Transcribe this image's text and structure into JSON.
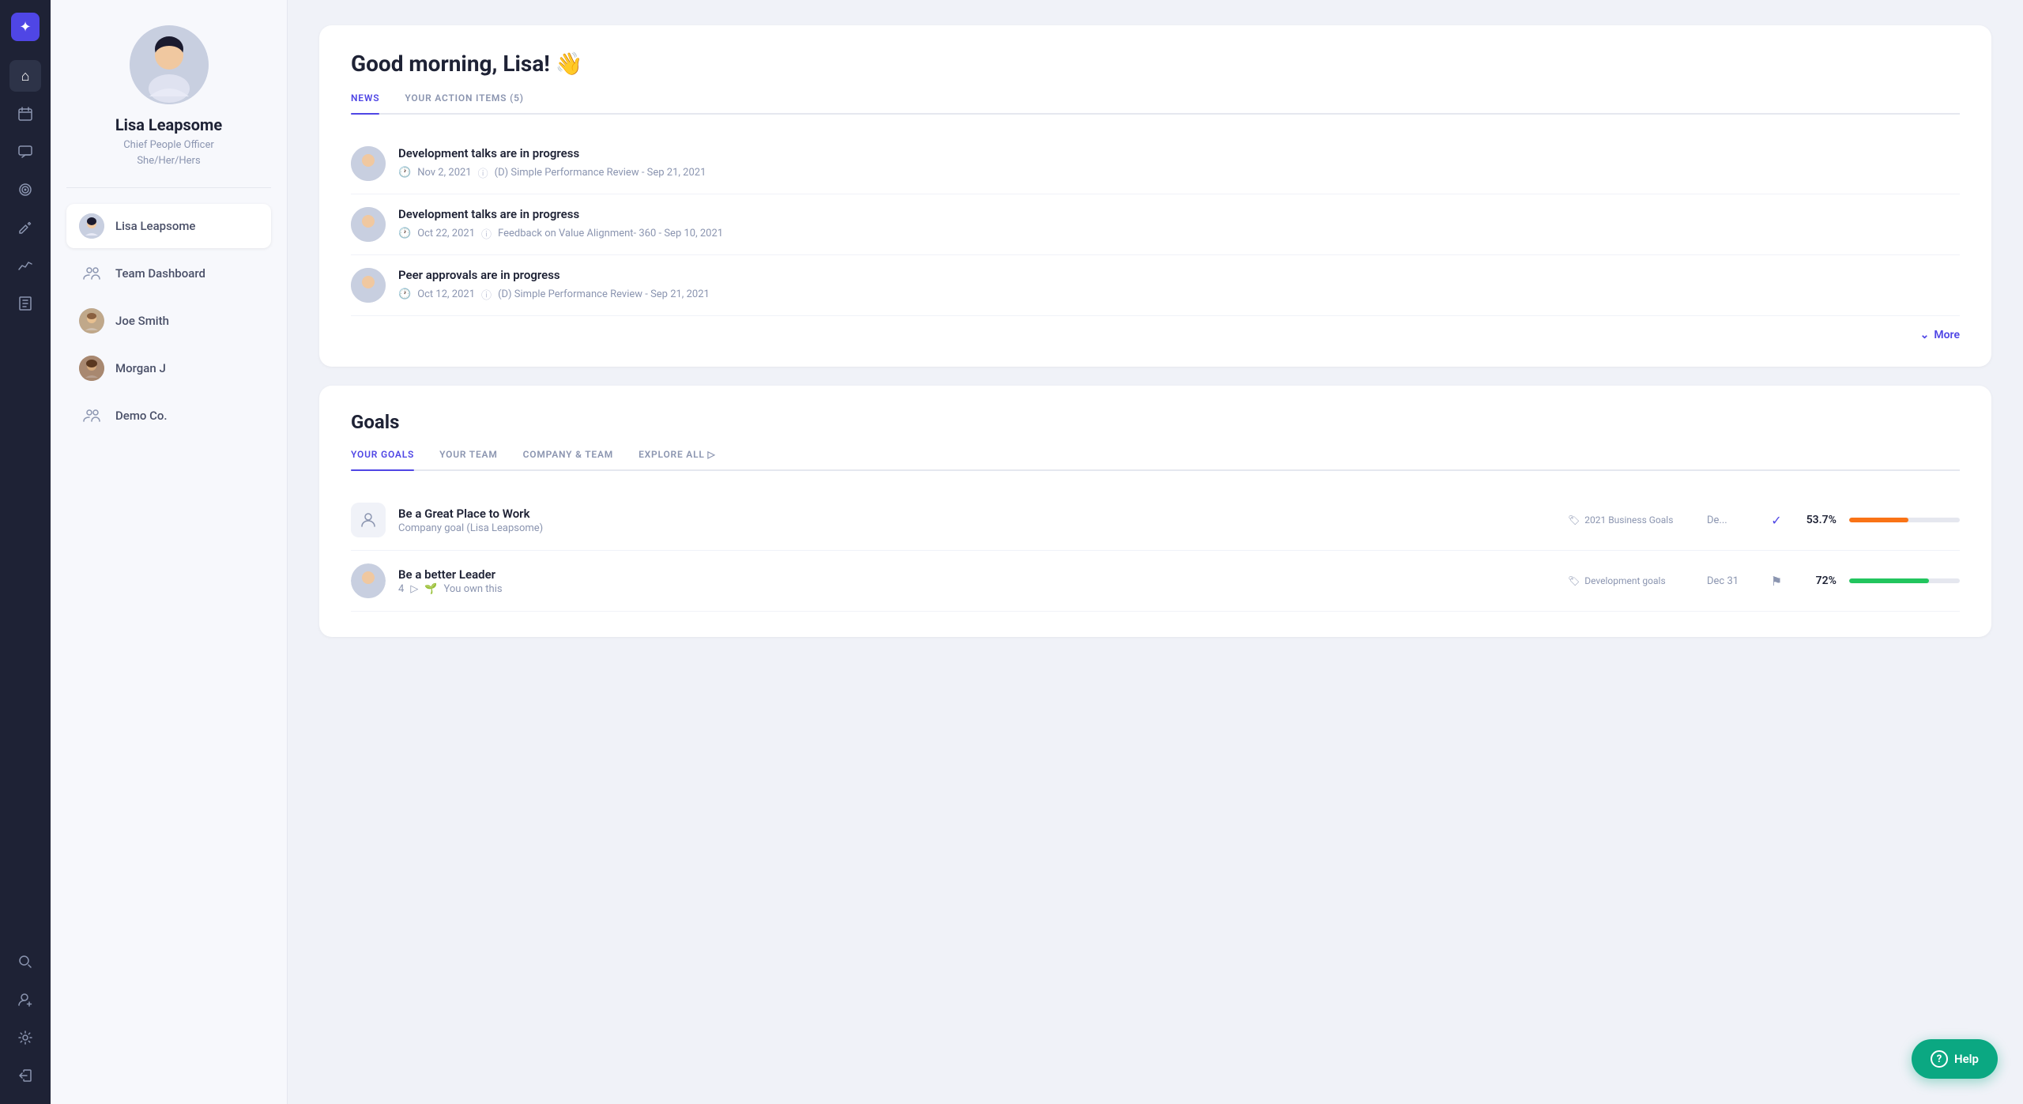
{
  "app": {
    "logo": "✦"
  },
  "sidebar_icons": [
    {
      "name": "home-icon",
      "glyph": "⌂",
      "active": true
    },
    {
      "name": "calendar-icon",
      "glyph": "▦"
    },
    {
      "name": "chat-icon",
      "glyph": "💬"
    },
    {
      "name": "target-icon",
      "glyph": "◎"
    },
    {
      "name": "edit-icon",
      "glyph": "✎"
    },
    {
      "name": "chart-icon",
      "glyph": "∿"
    },
    {
      "name": "book-icon",
      "glyph": "☰"
    }
  ],
  "sidebar_bottom_icons": [
    {
      "name": "search-icon",
      "glyph": "⌕"
    },
    {
      "name": "add-icon",
      "glyph": "+"
    },
    {
      "name": "settings-icon",
      "glyph": "⚙"
    },
    {
      "name": "logout-icon",
      "glyph": "→"
    }
  ],
  "profile": {
    "name": "Lisa Leapsome",
    "title": "Chief People Officer",
    "pronouns": "She/Her/Hers",
    "avatar_emoji": "👩"
  },
  "nav_items": [
    {
      "id": "lisa",
      "label": "Lisa Leapsome",
      "type": "avatar",
      "avatar_emoji": "👩",
      "active": true
    },
    {
      "id": "team",
      "label": "Team Dashboard",
      "type": "group"
    },
    {
      "id": "joe",
      "label": "Joe Smith",
      "type": "avatar",
      "avatar_emoji": "👨"
    },
    {
      "id": "morgan",
      "label": "Morgan J",
      "type": "avatar",
      "avatar_emoji": "👩‍🦱"
    },
    {
      "id": "demo",
      "label": "Demo Co.",
      "type": "group"
    }
  ],
  "news": {
    "greeting": "Good morning, Lisa! 👋",
    "tabs": [
      {
        "label": "NEWS",
        "active": true
      },
      {
        "label": "YOUR ACTION ITEMS (5)",
        "active": false
      }
    ],
    "items": [
      {
        "title": "Development talks are in progress",
        "date": "Nov 2, 2021",
        "review": "(D) Simple Performance Review - Sep 21, 2021",
        "avatar_emoji": "👩"
      },
      {
        "title": "Development talks are in progress",
        "date": "Oct 22, 2021",
        "review": "Feedback on Value Alignment- 360 - Sep 10, 2021",
        "avatar_emoji": "👩"
      },
      {
        "title": "Peer approvals are in progress",
        "date": "Oct 12, 2021",
        "review": "(D) Simple Performance Review - Sep 21, 2021",
        "avatar_emoji": "👩"
      }
    ],
    "more_label": "More"
  },
  "goals": {
    "section_title": "Goals",
    "tabs": [
      {
        "label": "YOUR GOALS",
        "active": true
      },
      {
        "label": "YOUR TEAM",
        "active": false
      },
      {
        "label": "COMPANY & TEAM",
        "active": false
      },
      {
        "label": "EXPLORE ALL ▷",
        "active": false
      }
    ],
    "items": [
      {
        "name": "Be a Great Place to Work",
        "sub": "Company goal (Lisa Leapsome)",
        "tag": "2021 Business Goals",
        "date": "De...",
        "check": "✓",
        "flag": "",
        "percent": "53.7%",
        "progress": 53.7,
        "bar_color": "#f97316",
        "icon_emoji": "👤"
      },
      {
        "name": "Be a better Leader",
        "sub_parts": [
          "4",
          "▷",
          "🌱",
          "You own this"
        ],
        "tag": "Development goals",
        "date": "Dec 31",
        "check": "",
        "flag": "⚑",
        "percent": "72%",
        "progress": 72,
        "bar_color": "#22c55e",
        "icon_emoji": "👩",
        "has_avatar": true
      }
    ]
  },
  "help_button": {
    "label": "Help",
    "icon": "?"
  }
}
